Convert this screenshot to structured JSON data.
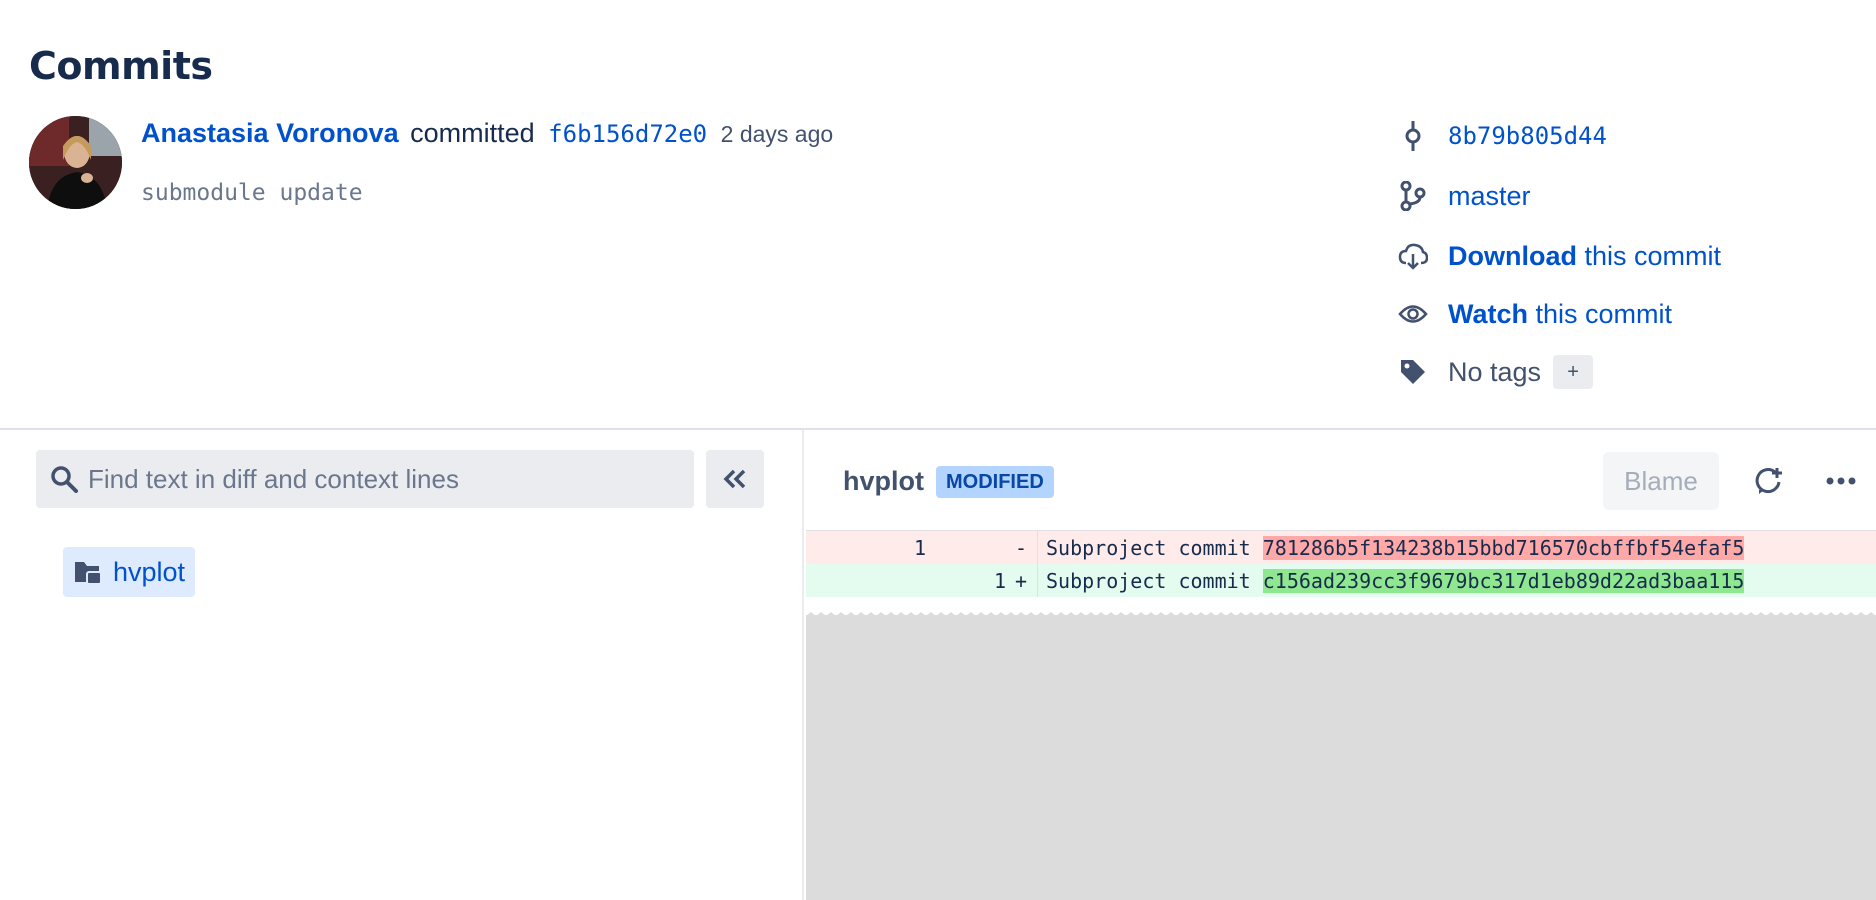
{
  "page": {
    "title": "Commits"
  },
  "commit": {
    "author": "Anastasia Voronova",
    "verb": "committed",
    "hash": "f6b156d72e0",
    "time": "2 days ago",
    "message": "submodule update"
  },
  "meta": {
    "parent_hash": "8b79b805d44",
    "branch": "master",
    "download_bold": "Download",
    "download_rest": "this commit",
    "watch_bold": "Watch",
    "watch_rest": "this commit",
    "tags_text": "No tags",
    "tags_add": "+"
  },
  "search": {
    "placeholder": "Find text in diff and context lines",
    "value": ""
  },
  "tree": {
    "items": [
      {
        "label": "hvplot",
        "icon": "folder-icon"
      }
    ]
  },
  "diff": {
    "file_name": "hvplot",
    "status_badge": "MODIFIED",
    "blame_label": "Blame",
    "lines": [
      {
        "type": "del",
        "old": "1",
        "new": "",
        "sign": "-",
        "prefix": "Subproject commit ",
        "hash": "781286b5f134238b15bbd716570cbffbf54efaf5"
      },
      {
        "type": "add",
        "old": "",
        "new": "1",
        "sign": "+",
        "prefix": "Subproject commit ",
        "hash": "c156ad239cc3f9679bc317d1eb89d22ad3baa115"
      }
    ]
  },
  "colors": {
    "accent": "#0052cc",
    "text": "#172b4d",
    "muted": "#42526e",
    "del_bg": "#ffebe9",
    "add_bg": "#e3fcef"
  }
}
